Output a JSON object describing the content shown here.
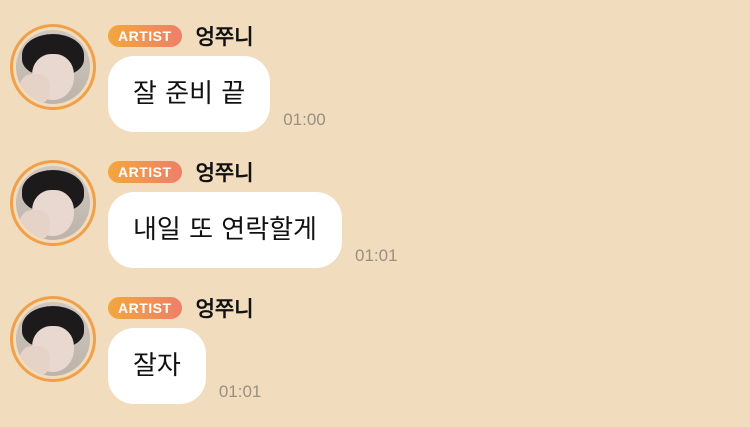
{
  "messages": [
    {
      "badge": "ARTIST",
      "sender": "엉쭈니",
      "text": "잘 준비 끝",
      "time": "01:00"
    },
    {
      "badge": "ARTIST",
      "sender": "엉쭈니",
      "text": "내일 또 연락할게",
      "time": "01:01"
    },
    {
      "badge": "ARTIST",
      "sender": "엉쭈니",
      "text": "잘자",
      "time": "01:01"
    }
  ],
  "colors": {
    "background": "#f1dcbd",
    "avatar_ring": "#f0a04a",
    "badge_start": "#f3a73c",
    "badge_end": "#ee7f6a",
    "bubble": "#ffffff",
    "time_text": "#9a8f82"
  }
}
